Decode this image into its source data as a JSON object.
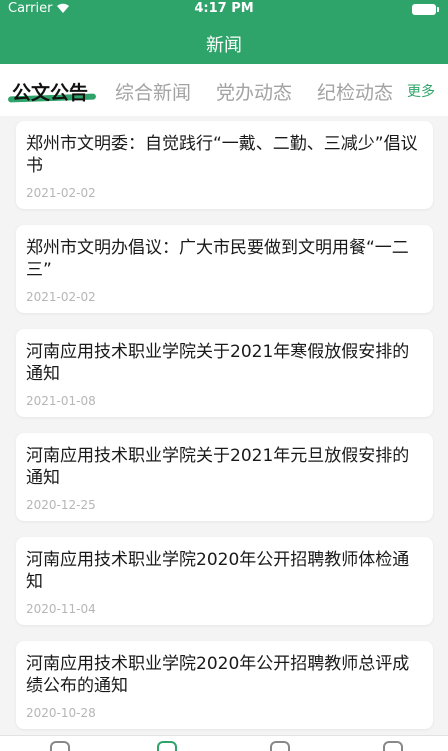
{
  "status": {
    "carrier": "Carrier",
    "time": "4:17 PM"
  },
  "header": {
    "title": "新闻"
  },
  "tabs": [
    {
      "label": "公文公告",
      "active": true
    },
    {
      "label": "综合新闻",
      "active": false
    },
    {
      "label": "党办动态",
      "active": false
    },
    {
      "label": "纪检动态",
      "active": false
    }
  ],
  "more_label": "更多",
  "news": [
    {
      "title": "郑州市文明委：自觉践行“一戴、二勤、三减少”倡议书",
      "date": "2021-02-02"
    },
    {
      "title": "郑州市文明办倡议：广大市民要做到文明用餐“一二三”",
      "date": "2021-02-02"
    },
    {
      "title": "河南应用技术职业学院关于2021年寒假放假安排的通知",
      "date": "2021-01-08"
    },
    {
      "title": "河南应用技术职业学院关于2021年元旦放假安排的通知",
      "date": "2020-12-25"
    },
    {
      "title": "河南应用技术职业学院2020年公开招聘教师体检通知",
      "date": "2020-11-04"
    },
    {
      "title": "河南应用技术职业学院2020年公开招聘教师总评成绩公布的通知",
      "date": "2020-10-28"
    }
  ],
  "colors": {
    "accent": "#2fa46a",
    "background": "#f4f4f4"
  },
  "tabbar_icons": [
    "home-icon",
    "news-icon",
    "people-icon",
    "user-icon"
  ]
}
